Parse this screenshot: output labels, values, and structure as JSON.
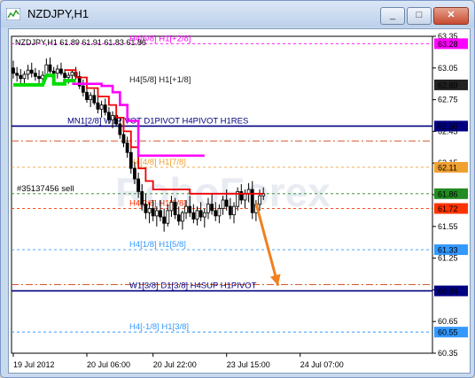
{
  "window": {
    "title": "NZDJPY,H1",
    "buttons": [
      "_",
      "□",
      "✕"
    ],
    "button_icons": [
      "minimize-icon",
      "restore-icon",
      "close-icon"
    ]
  },
  "chart_data": {
    "type": "candlestick",
    "symbol_header": "NZDJPY,H1  61.89 61.91 61.83 61.86",
    "ylim": [
      60.35,
      63.35
    ],
    "y_ticks": [
      63.35,
      63.05,
      62.75,
      62.45,
      62.15,
      61.85,
      61.55,
      61.25,
      60.95,
      60.65,
      60.35
    ],
    "x_ticks": [
      "19 Jul 2012",
      "20 Jul 06:00",
      "20 Jul 22:00",
      "23 Jul 15:00",
      "24 Jul 07:00"
    ],
    "x_tick_index": [
      0,
      20,
      38,
      58,
      78
    ],
    "levels": [
      {
        "label": "H4[6/8] H1[+2/8]",
        "value": 63.28,
        "tag": "63.28",
        "color": "#ff00ff",
        "style": "dash"
      },
      {
        "label": "",
        "value": 62.89,
        "tag": "62.89",
        "color": "#222222",
        "style": "none"
      },
      {
        "label": "H4[5/8] H1[+1/8]",
        "value": 62.89,
        "tag": "",
        "color": "#222222",
        "style": "text"
      },
      {
        "label": "MN1[2/8] W1PIVOT D1PIVOT H4PIVOT H1RES",
        "value": 62.5,
        "tag": "62.50",
        "color": "#000080",
        "style": "solid"
      },
      {
        "label": "",
        "value": 62.36,
        "tag": "",
        "color": "#d04010",
        "style": "dashdot"
      },
      {
        "label": "H4[4/8] H1[7/8]",
        "value": 62.11,
        "tag": "62.11",
        "color": "#f0a030",
        "style": "dash"
      },
      {
        "label": "#35137456 sell",
        "value": 61.86,
        "tag": "61.86",
        "color": "#228b22",
        "style": "dash"
      },
      {
        "label": "H4[2/8] H1[6/8]",
        "value": 61.72,
        "tag": "61.72",
        "color": "#ff3300",
        "style": "dash"
      },
      {
        "label": "H4[1/8] H1[5/8]",
        "value": 61.33,
        "tag": "61.33",
        "color": "#3399ff",
        "style": "dash"
      },
      {
        "label": "",
        "value": 61.0,
        "tag": "",
        "color": "#d04010",
        "style": "dashdot"
      },
      {
        "label": "W1[3/8] D1[3/8] H4SUP H1PIVOT",
        "value": 60.94,
        "tag": "60.94",
        "color": "#000080",
        "style": "solid"
      },
      {
        "label": "H4[-1/8] H1[3/8]",
        "value": 60.55,
        "tag": "60.55",
        "color": "#3399ff",
        "style": "dash"
      }
    ],
    "candles": [
      [
        63.05,
        63.12,
        62.95,
        63.0
      ],
      [
        63.0,
        63.06,
        62.92,
        62.98
      ],
      [
        62.98,
        63.04,
        62.9,
        62.95
      ],
      [
        62.95,
        63.02,
        62.88,
        62.99
      ],
      [
        62.99,
        63.08,
        62.94,
        63.03
      ],
      [
        63.03,
        63.1,
        62.96,
        63.0
      ],
      [
        63.0,
        63.05,
        62.93,
        62.97
      ],
      [
        62.97,
        63.03,
        62.9,
        62.95
      ],
      [
        62.95,
        63.02,
        62.89,
        62.98
      ],
      [
        62.98,
        63.14,
        62.96,
        63.08
      ],
      [
        63.08,
        63.15,
        63.0,
        63.02
      ],
      [
        63.02,
        63.06,
        62.97,
        63.0
      ],
      [
        63.0,
        63.08,
        62.95,
        63.04
      ],
      [
        63.04,
        63.1,
        62.98,
        63.0
      ],
      [
        63.0,
        63.04,
        62.93,
        62.96
      ],
      [
        62.96,
        63.01,
        62.9,
        62.98
      ],
      [
        62.98,
        63.03,
        62.92,
        63.01
      ],
      [
        63.01,
        63.06,
        62.94,
        62.97
      ],
      [
        62.97,
        63.02,
        62.85,
        62.88
      ],
      [
        62.88,
        62.94,
        62.78,
        62.82
      ],
      [
        62.82,
        62.88,
        62.72,
        62.75
      ],
      [
        62.75,
        62.82,
        62.68,
        62.79
      ],
      [
        62.79,
        62.85,
        62.7,
        62.72
      ],
      [
        62.72,
        62.78,
        62.62,
        62.66
      ],
      [
        62.66,
        62.74,
        62.58,
        62.7
      ],
      [
        62.7,
        62.76,
        62.6,
        62.63
      ],
      [
        62.63,
        62.68,
        62.52,
        62.56
      ],
      [
        62.56,
        62.64,
        62.48,
        62.6
      ],
      [
        62.6,
        62.66,
        62.5,
        62.52
      ],
      [
        62.52,
        62.58,
        62.38,
        62.42
      ],
      [
        62.42,
        62.5,
        62.3,
        62.34
      ],
      [
        62.34,
        62.4,
        62.2,
        62.25
      ],
      [
        62.25,
        62.3,
        62.05,
        62.1
      ],
      [
        62.1,
        62.16,
        61.95,
        62.0
      ],
      [
        62.0,
        62.06,
        61.82,
        61.88
      ],
      [
        61.88,
        61.95,
        61.7,
        61.76
      ],
      [
        61.76,
        61.86,
        61.62,
        61.68
      ],
      [
        61.68,
        61.78,
        61.58,
        61.72
      ],
      [
        61.72,
        61.8,
        61.6,
        61.65
      ],
      [
        61.65,
        61.74,
        61.55,
        61.7
      ],
      [
        61.7,
        61.8,
        61.6,
        61.64
      ],
      [
        61.64,
        61.72,
        61.5,
        61.58
      ],
      [
        61.58,
        61.76,
        61.55,
        61.7
      ],
      [
        61.7,
        61.84,
        61.64,
        61.78
      ],
      [
        61.78,
        61.82,
        61.62,
        61.66
      ],
      [
        61.66,
        61.74,
        61.56,
        61.6
      ],
      [
        61.6,
        61.7,
        61.52,
        61.68
      ],
      [
        61.68,
        61.8,
        61.62,
        61.74
      ],
      [
        61.74,
        61.84,
        61.64,
        61.68
      ],
      [
        61.68,
        61.76,
        61.58,
        61.62
      ],
      [
        61.62,
        61.74,
        61.56,
        61.7
      ],
      [
        61.7,
        61.78,
        61.6,
        61.64
      ],
      [
        61.64,
        61.72,
        61.54,
        61.68
      ],
      [
        61.68,
        61.82,
        61.62,
        61.76
      ],
      [
        61.76,
        61.86,
        61.66,
        61.7
      ],
      [
        61.7,
        61.78,
        61.6,
        61.65
      ],
      [
        61.65,
        61.76,
        61.58,
        61.72
      ],
      [
        61.72,
        61.84,
        61.66,
        61.8
      ],
      [
        61.8,
        61.9,
        61.7,
        61.74
      ],
      [
        61.74,
        61.82,
        61.62,
        61.66
      ],
      [
        61.66,
        61.78,
        61.58,
        61.74
      ],
      [
        61.74,
        61.92,
        61.7,
        61.88
      ],
      [
        61.88,
        61.95,
        61.76,
        61.8
      ],
      [
        61.8,
        61.9,
        61.72,
        61.86
      ],
      [
        61.86,
        61.96,
        61.78,
        61.9
      ],
      [
        61.9,
        61.98,
        61.62,
        61.68
      ],
      [
        61.68,
        61.8,
        61.6,
        61.76
      ],
      [
        61.76,
        61.9,
        61.7,
        61.84
      ],
      [
        61.84,
        61.92,
        61.8,
        61.86
      ]
    ],
    "indicator_lines": [
      {
        "name": "",
        "color": "#00dd00",
        "points": [
          [
            0,
            62.89
          ],
          [
            8,
            62.89
          ],
          [
            9,
            62.98
          ],
          [
            11,
            62.98
          ],
          [
            11,
            62.9
          ],
          [
            14,
            62.9
          ],
          [
            14,
            62.93
          ],
          [
            17,
            62.93
          ]
        ]
      },
      {
        "name": "",
        "color": "#ee0000",
        "points": [
          [
            14,
            63.03
          ],
          [
            17,
            63.03
          ],
          [
            17,
            62.96
          ],
          [
            20,
            62.96
          ],
          [
            20,
            62.86
          ],
          [
            23,
            62.86
          ],
          [
            23,
            62.78
          ],
          [
            26,
            62.78
          ],
          [
            26,
            62.7
          ],
          [
            28,
            62.7
          ],
          [
            28,
            62.58
          ],
          [
            30,
            62.58
          ],
          [
            30,
            62.45
          ],
          [
            32,
            62.45
          ],
          [
            32,
            62.3
          ],
          [
            34,
            62.3
          ],
          [
            34,
            62.1
          ],
          [
            36,
            62.1
          ],
          [
            36,
            61.98
          ],
          [
            38,
            61.98
          ],
          [
            38,
            61.9
          ],
          [
            48,
            61.9
          ],
          [
            48,
            61.86
          ],
          [
            68,
            61.86
          ]
        ]
      },
      {
        "name": "",
        "color": "#ff00ff",
        "points": [
          [
            16,
            62.9
          ],
          [
            24,
            62.9
          ],
          [
            24,
            62.88
          ],
          [
            27,
            62.88
          ],
          [
            27,
            62.82
          ],
          [
            29,
            62.82
          ],
          [
            29,
            62.7
          ],
          [
            31,
            62.7
          ],
          [
            31,
            62.55
          ],
          [
            34,
            62.55
          ],
          [
            34,
            62.22
          ],
          [
            52,
            62.22
          ]
        ]
      }
    ],
    "forecast_arrow": {
      "color": "#f08020",
      "from": [
        66,
        61.77
      ],
      "to": [
        72,
        60.99
      ]
    }
  }
}
